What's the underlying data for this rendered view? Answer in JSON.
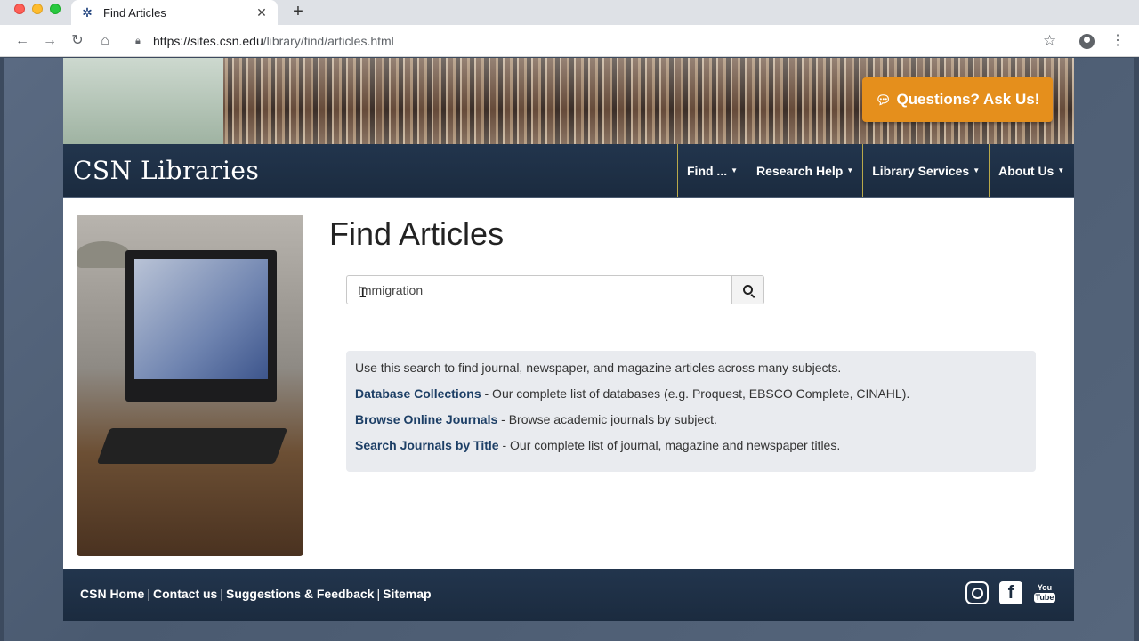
{
  "browser": {
    "tab_title": "Find Articles",
    "tab_close": "✕",
    "new_tab": "+",
    "url_host": "https://sites.csn.edu",
    "url_path": "/library/find/articles.html",
    "icons": [
      "back-icon",
      "forward-icon",
      "reload-icon",
      "home-icon",
      "lock-icon",
      "star-icon",
      "profile-icon",
      "menu-icon"
    ]
  },
  "header": {
    "ask_button": "Questions? Ask Us!",
    "brand": "CSN Libraries",
    "nav": [
      {
        "label": "Find ..."
      },
      {
        "label": "Research Help"
      },
      {
        "label": "Library Services"
      },
      {
        "label": "About Us"
      }
    ]
  },
  "main": {
    "title": "Find Articles",
    "search": {
      "value": "Immigration",
      "placeholder": ""
    },
    "info": {
      "intro": "Use this search to find journal, newspaper, and magazine articles across many subjects.",
      "links": [
        {
          "label": "Database Collections",
          "desc": " - Our complete list of databases (e.g. Proquest, EBSCO Complete, CINAHL)."
        },
        {
          "label": "Browse Online Journals",
          "desc": " - Browse academic journals by subject."
        },
        {
          "label": "Search Journals by Title",
          "desc": " - Our complete list of journal, magazine and newspaper titles."
        }
      ]
    }
  },
  "footer": {
    "links": [
      {
        "label": "CSN Home"
      },
      {
        "label": "Contact us"
      },
      {
        "label": "Suggestions & Feedback"
      },
      {
        "label": "Sitemap"
      }
    ],
    "separator": "|",
    "social": [
      "instagram-icon",
      "facebook-icon",
      "youtube-icon"
    ]
  },
  "colors": {
    "navbar": "#1b2b3f",
    "accent_button": "#e58f1c",
    "link": "#1d3f66",
    "nav_divider": "#b9a94a"
  }
}
